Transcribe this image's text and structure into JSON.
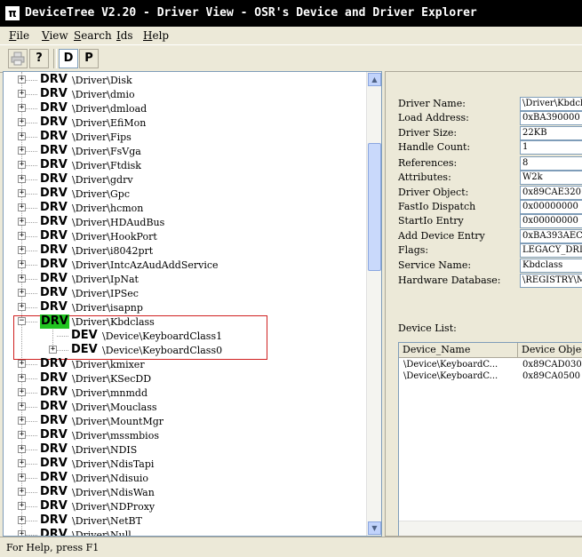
{
  "window": {
    "title": "DeviceTree V2.20 - Driver View - OSR's Device and Driver Explorer",
    "icon": "pi-icon"
  },
  "menu": [
    {
      "label": "File",
      "key": "F",
      "rest": "ile"
    },
    {
      "label": "View",
      "key": "V",
      "rest": "iew"
    },
    {
      "label": "Search",
      "key": "S",
      "rest": "earch"
    },
    {
      "label": "Ids",
      "key": "I",
      "rest": "ds"
    },
    {
      "label": "Help",
      "key": "H",
      "rest": "elp"
    }
  ],
  "toolbar": {
    "print_icon": "printer-icon",
    "help_icon": "?",
    "d_label": "D",
    "p_label": "P"
  },
  "tree": {
    "rows": [
      {
        "tag": "DRV",
        "path": "\\Driver\\Disk"
      },
      {
        "tag": "DRV",
        "path": "\\Driver\\dmio"
      },
      {
        "tag": "DRV",
        "path": "\\Driver\\dmload"
      },
      {
        "tag": "DRV",
        "path": "\\Driver\\EfiMon"
      },
      {
        "tag": "DRV",
        "path": "\\Driver\\Fips"
      },
      {
        "tag": "DRV",
        "path": "\\Driver\\FsVga"
      },
      {
        "tag": "DRV",
        "path": "\\Driver\\Ftdisk"
      },
      {
        "tag": "DRV",
        "path": "\\Driver\\gdrv"
      },
      {
        "tag": "DRV",
        "path": "\\Driver\\Gpc"
      },
      {
        "tag": "DRV",
        "path": "\\Driver\\hcmon"
      },
      {
        "tag": "DRV",
        "path": "\\Driver\\HDAudBus"
      },
      {
        "tag": "DRV",
        "path": "\\Driver\\HookPort"
      },
      {
        "tag": "DRV",
        "path": "\\Driver\\i8042prt"
      },
      {
        "tag": "DRV",
        "path": "\\Driver\\IntcAzAudAddService"
      },
      {
        "tag": "DRV",
        "path": "\\Driver\\IpNat"
      },
      {
        "tag": "DRV",
        "path": "\\Driver\\IPSec"
      },
      {
        "tag": "DRV",
        "path": "\\Driver\\isapnp"
      },
      {
        "tag": "DRV",
        "path": "\\Driver\\Kbdclass",
        "selected": true,
        "expanded": true
      },
      {
        "tag": "DEV",
        "path": "\\Device\\KeyboardClass1",
        "child": true
      },
      {
        "tag": "DEV",
        "path": "\\Device\\KeyboardClass0",
        "child": true
      },
      {
        "tag": "DRV",
        "path": "\\Driver\\kmixer"
      },
      {
        "tag": "DRV",
        "path": "\\Driver\\KSecDD"
      },
      {
        "tag": "DRV",
        "path": "\\Driver\\mnmdd"
      },
      {
        "tag": "DRV",
        "path": "\\Driver\\Mouclass"
      },
      {
        "tag": "DRV",
        "path": "\\Driver\\MountMgr"
      },
      {
        "tag": "DRV",
        "path": "\\Driver\\mssmbios"
      },
      {
        "tag": "DRV",
        "path": "\\Driver\\NDIS"
      },
      {
        "tag": "DRV",
        "path": "\\Driver\\NdisTapi"
      },
      {
        "tag": "DRV",
        "path": "\\Driver\\Ndisuio"
      },
      {
        "tag": "DRV",
        "path": "\\Driver\\NdisWan"
      },
      {
        "tag": "DRV",
        "path": "\\Driver\\NDProxy"
      },
      {
        "tag": "DRV",
        "path": "\\Driver\\NetBT"
      },
      {
        "tag": "DRV",
        "path": "\\Driver\\Null"
      }
    ]
  },
  "properties": [
    {
      "label": "Driver Name:",
      "value": "\\Driver\\Kbdclass"
    },
    {
      "label": "Load Address:",
      "value": "0xBA390000"
    },
    {
      "label": "Driver Size:",
      "value": "22KB"
    },
    {
      "label": "Handle Count:",
      "value": "1"
    },
    {
      "label": "References:",
      "value": "8"
    },
    {
      "label": "Attributes:",
      "value": "W2k"
    },
    {
      "label": "Driver Object:",
      "value": "0x89CAE320"
    },
    {
      "label": "FastIo Dispatch",
      "value": "0x00000000"
    },
    {
      "label": "StartIo Entry",
      "value": "0x00000000"
    },
    {
      "label": "Add Device Entry",
      "value": "0xBA393AEC"
    },
    {
      "label": "Flags:",
      "value": "LEGACY_DRIVER"
    },
    {
      "label": "Service Name:",
      "value": "Kbdclass"
    },
    {
      "label": "Hardware Database:",
      "value": "\\REGISTRY\\MACHINE"
    }
  ],
  "device_list": {
    "label": "Device List:",
    "columns": [
      "Device_Name",
      "Device Object"
    ],
    "rows": [
      [
        "\\Device\\KeyboardC...",
        "0x89CAD030"
      ],
      [
        "\\Device\\KeyboardC...",
        "0x89CA0500"
      ]
    ]
  },
  "status": {
    "text": "For Help, press F1"
  }
}
